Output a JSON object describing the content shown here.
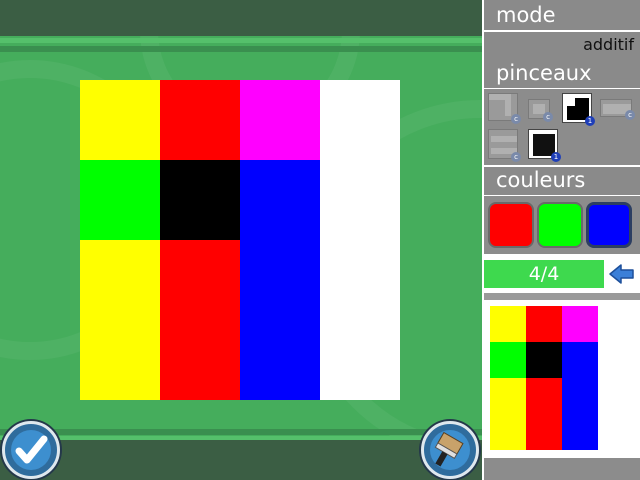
{
  "panel": {
    "mode_label": "mode",
    "mode_value": "additif",
    "brushes_label": "pinceaux",
    "colors_label": "couleurs",
    "progress_text": "4/4",
    "progress_value": 1.0
  },
  "palette": [
    {
      "name": "red",
      "color": "#ff0000",
      "selected": false
    },
    {
      "name": "green",
      "color": "#00ff00",
      "selected": false
    },
    {
      "name": "blue",
      "color": "#0000ff",
      "selected": true
    }
  ],
  "brushes": [
    {
      "icon": "corner-brush-icon",
      "badge": "c",
      "active": false
    },
    {
      "icon": "small-square-brush-icon",
      "badge": "c",
      "active": false
    },
    {
      "icon": "L-grid-brush-icon",
      "badge": "1",
      "active": true
    },
    {
      "icon": "bar-brush-icon",
      "badge": "c",
      "active": false
    },
    {
      "icon": "line-brush-icon",
      "badge": "c",
      "active": false
    },
    {
      "icon": "grid-brush-icon",
      "badge": "1",
      "active": true
    }
  ],
  "canvas_grid": [
    [
      "#ffff00",
      "#ff0000",
      "#ff00ff",
      "#ffffff"
    ],
    [
      "#00ff00",
      "#000000",
      "#0000ff",
      "#ffffff"
    ],
    [
      "#ffff00",
      "#ff0000",
      "#0000ff",
      "#ffffff"
    ],
    [
      "#ffff00",
      "#ff0000",
      "#0000ff",
      "#ffffff"
    ]
  ],
  "target_grid": [
    [
      "#ffff00",
      "#ff0000",
      "#ff00ff"
    ],
    [
      "#00ff00",
      "#000000",
      "#0000ff"
    ],
    [
      "#ffff00",
      "#ff0000",
      "#0000ff"
    ],
    [
      "#ffff00",
      "#ff0000",
      "#0000ff"
    ]
  ],
  "buttons": {
    "validate_icon": "checkmark-icon",
    "paint_icon": "paintbrush-icon"
  }
}
